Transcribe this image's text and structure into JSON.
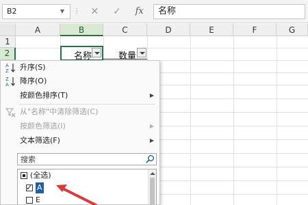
{
  "formula_bar": {
    "name_box": "B2",
    "cancel_icon": "✕",
    "enter_icon": "✓",
    "fx_label": "fx",
    "content": "名称"
  },
  "grid": {
    "columns": [
      "A",
      "B",
      "C",
      "D",
      "E",
      "F",
      "G"
    ],
    "rows": [
      "1",
      "2"
    ],
    "cells": {
      "B2": "名称",
      "C2": "数量"
    }
  },
  "filter_menu": {
    "items": [
      {
        "label": "升序(S)",
        "icon": "sort-ascending-icon",
        "disabled": false,
        "submenu": false
      },
      {
        "label": "降序(O)",
        "icon": "sort-descending-icon",
        "disabled": false,
        "submenu": false
      },
      {
        "label": "按颜色排序(T)",
        "disabled": false,
        "submenu": true
      },
      {
        "label": "从\"名称\"中清除筛选(C)",
        "icon": "clear-filter-icon",
        "disabled": true,
        "submenu": false
      },
      {
        "label": "按颜色筛选(I)",
        "disabled": true,
        "submenu": true
      },
      {
        "label": "文本筛选(F)",
        "disabled": false,
        "submenu": true
      }
    ],
    "search_placeholder": "搜索",
    "list": [
      {
        "label": "(全选)",
        "state": "mixed"
      },
      {
        "label": "A",
        "state": "checked",
        "highlighted": true
      },
      {
        "label": "E",
        "state": "unchecked"
      }
    ]
  },
  "colors": {
    "accent": "#217346",
    "annotation_arrow": "#d93a3a",
    "selection_highlight": "#1f5fa8"
  }
}
